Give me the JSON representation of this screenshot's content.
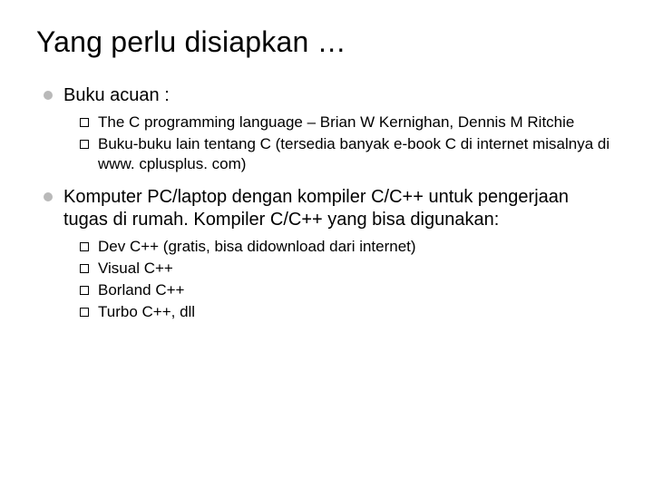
{
  "title": "Yang perlu disiapkan …",
  "items": [
    {
      "label": "Buku acuan :",
      "children": [
        {
          "label": "The C programming language – Brian W Kernighan, Dennis M Ritchie"
        },
        {
          "label": "Buku-buku lain tentang C (tersedia banyak e-book C di internet misalnya di www. cplusplus. com)"
        }
      ]
    },
    {
      "label": "Komputer PC/laptop dengan kompiler C/C++ untuk pengerjaan tugas di rumah. Kompiler C/C++ yang bisa digunakan:",
      "children": [
        {
          "label": "Dev C++ (gratis, bisa didownload dari internet)"
        },
        {
          "label": "Visual C++"
        },
        {
          "label": "Borland C++"
        },
        {
          "label": "Turbo C++, dll"
        }
      ]
    }
  ]
}
